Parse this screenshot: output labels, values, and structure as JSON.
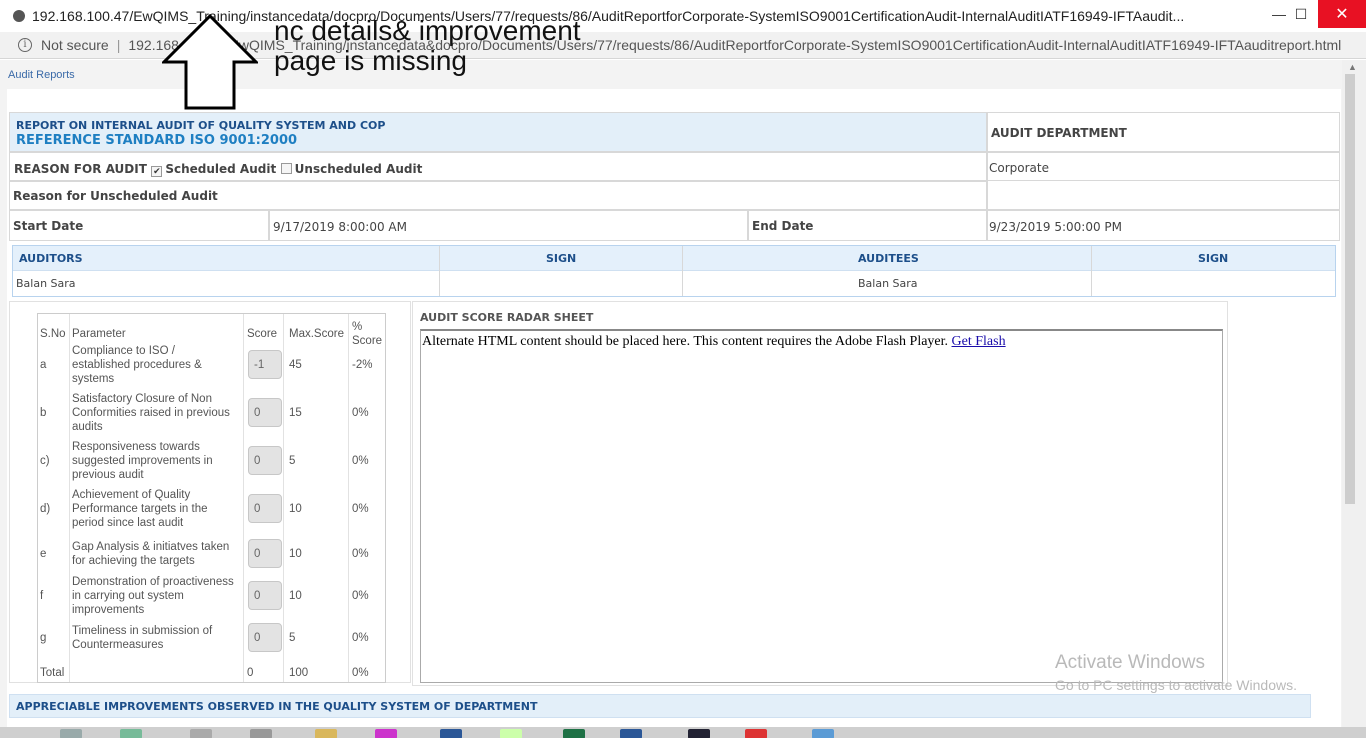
{
  "browser": {
    "title": "192.168.100.47/EwQIMS_Training/instancedata/docpro/Documents/Users/77/requests/86/AuditReportforCorporate-SystemISO9001CertificationAudit-InternalAuditIATF16949-IFTAaudit...",
    "security_label": "Not secure",
    "url": "192.168.100.47/EwQIMS_Training/instancedata&docpro/Documents/Users/77/requests/86/AuditReportforCorporate-SystemISO9001CertificationAudit-InternalAuditIATF16949-IFTAauditreport.html",
    "minimize": "—",
    "maximize": "☐",
    "close": "✕"
  },
  "annotation": {
    "line1": "nc details& improvement",
    "line2": "page is missing"
  },
  "breadcrumb": "Audit Reports",
  "report": {
    "title": "REPORT ON INTERNAL AUDIT OF QUALITY SYSTEM AND COP",
    "standard": "REFERENCE STANDARD ISO 9001:2000",
    "audit_department_label": "AUDIT DEPARTMENT",
    "audit_department_value": "Corporate",
    "reason_label": "REASON FOR AUDIT",
    "scheduled_label": "Scheduled Audit",
    "scheduled_checked": true,
    "unscheduled_label": "Unscheduled Audit",
    "unscheduled_checked": false,
    "unscheduled_reason_label": "Reason for Unscheduled Audit",
    "start_date_label": "Start Date",
    "start_date_value": "9/17/2019 8:00:00 AM",
    "end_date_label": "End Date",
    "end_date_value": "9/23/2019 5:00:00 PM"
  },
  "auditors_table": {
    "headers": [
      "AUDITORS",
      "SIGN",
      "AUDITEES",
      "SIGN"
    ],
    "row": [
      "Balan Sara",
      "",
      "Balan Sara",
      ""
    ]
  },
  "score_table": {
    "headers": [
      "S.No",
      "Parameter",
      "Score",
      "Max.Score",
      "%",
      "Score"
    ],
    "rows": [
      {
        "sno": "a",
        "param": [
          "Compliance to ISO /",
          "established procedures &",
          "systems"
        ],
        "score": "-1",
        "max": "45",
        "pct": "-2%"
      },
      {
        "sno": "b",
        "param": [
          "Satisfactory Closure of Non",
          "Conformities raised in previous",
          "audits"
        ],
        "score": "0",
        "max": "15",
        "pct": "0%"
      },
      {
        "sno": "c)",
        "param": [
          "Responsiveness towards",
          "suggested improvements in",
          "previous audit"
        ],
        "score": "0",
        "max": "5",
        "pct": "0%"
      },
      {
        "sno": "d)",
        "param": [
          "Achievement of Quality",
          "Performance targets in the",
          "period since last audit"
        ],
        "score": "0",
        "max": "10",
        "pct": "0%"
      },
      {
        "sno": "e",
        "param": [
          "Gap Analysis & initiatves taken",
          "for achieving the targets"
        ],
        "score": "0",
        "max": "10",
        "pct": "0%"
      },
      {
        "sno": "f",
        "param": [
          "Demonstration of proactiveness",
          "in carrying out system",
          "improvements"
        ],
        "score": "0",
        "max": "10",
        "pct": "0%"
      },
      {
        "sno": "g",
        "param": [
          "Timeliness in submission of",
          "Countermeasures"
        ],
        "score": "0",
        "max": "5",
        "pct": "0%"
      }
    ],
    "total_label": "Total",
    "total_score": "0",
    "total_max": "100",
    "total_pct": "0%"
  },
  "radar": {
    "title": "AUDIT SCORE RADAR SHEET",
    "flash_text": "Alternate HTML content should be placed here. This content requires the Adobe Flash Player.",
    "flash_link": "Get Flash"
  },
  "improvements_header": "APPRECIABLE IMPROVEMENTS OBSERVED IN THE QUALITY SYSTEM OF DEPARTMENT",
  "watermark": {
    "line1": "Activate Windows",
    "line2": "Go to PC settings to activate Windows."
  }
}
